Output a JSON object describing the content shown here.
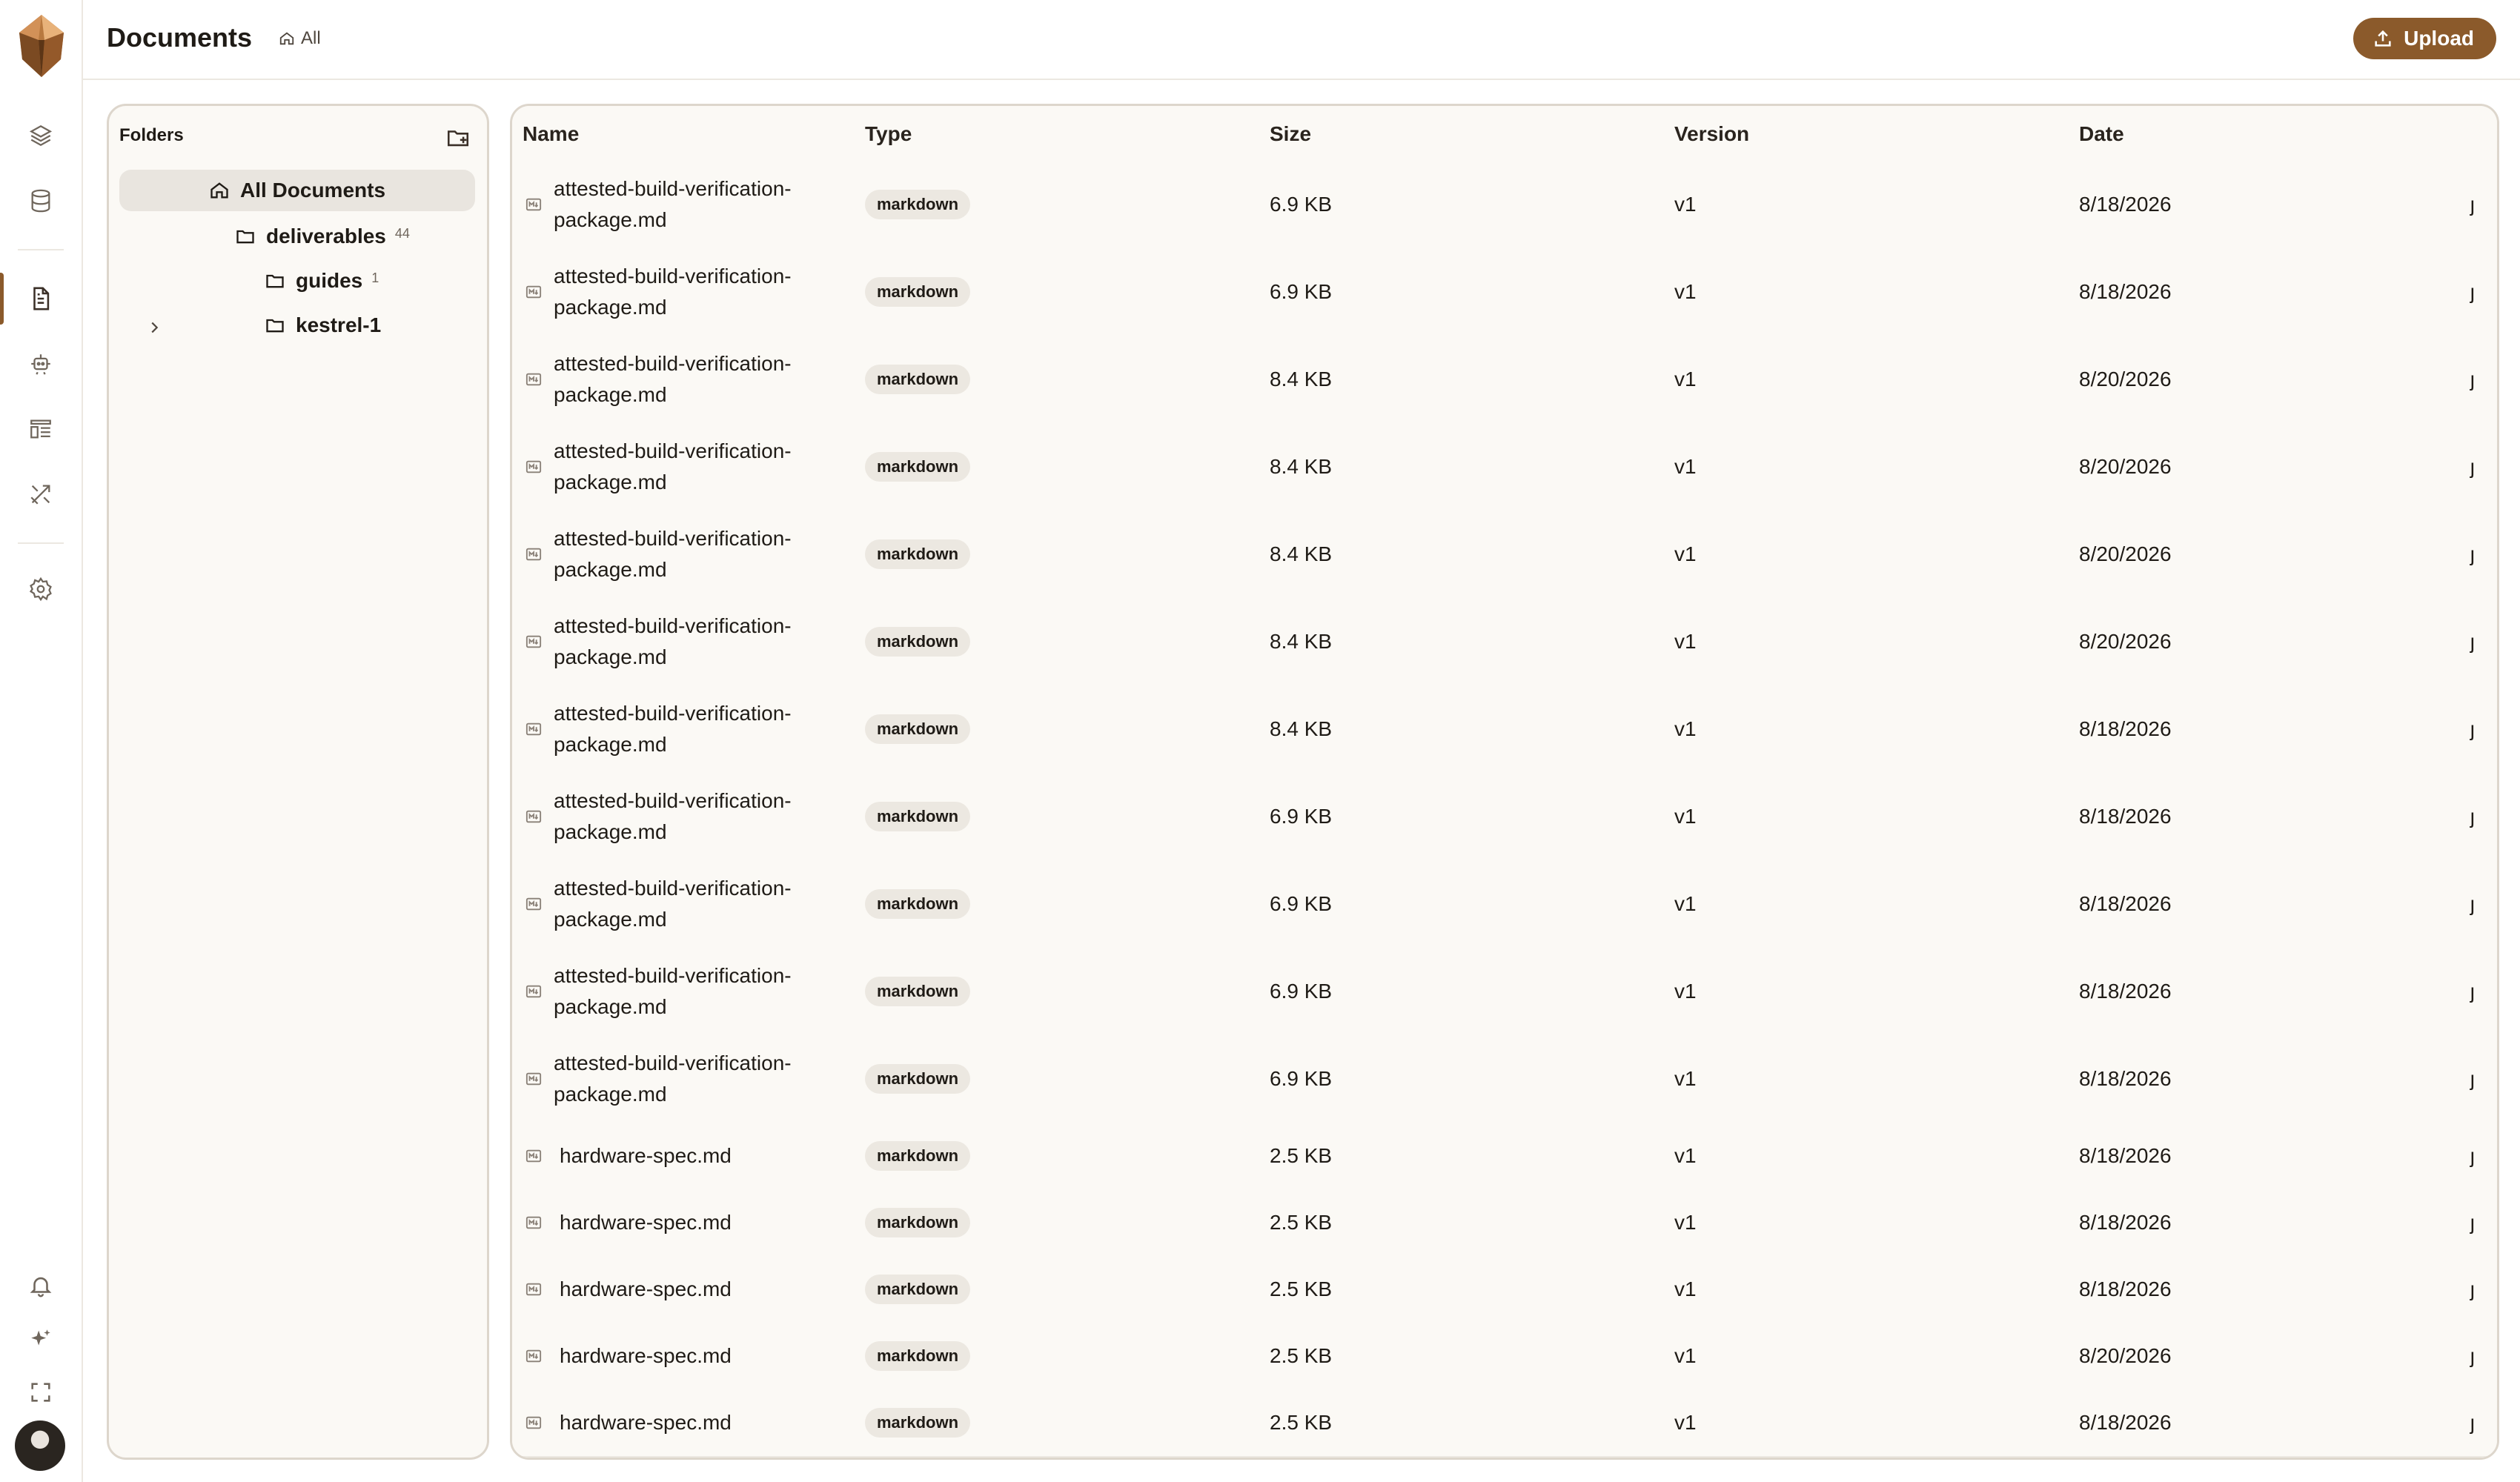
{
  "header": {
    "title": "Documents",
    "breadcrumb": "All",
    "upload_label": "Upload"
  },
  "folders": {
    "title": "Folders",
    "all_label": "All Documents",
    "items": [
      {
        "label": "deliverables",
        "count": "44"
      },
      {
        "label": "guides",
        "count": "1"
      },
      {
        "label": "kestrel-1",
        "count": ""
      }
    ]
  },
  "table": {
    "columns": [
      "Name",
      "Type",
      "Size",
      "Version",
      "Date"
    ],
    "rows": [
      {
        "name_line1": "attested-build-verification-",
        "name_line2": "package.md",
        "type": "markdown",
        "size": "6.9 KB",
        "version": "v1",
        "date": "8/18/2026"
      },
      {
        "name_line1": "attested-build-verification-",
        "name_line2": "package.md",
        "type": "markdown",
        "size": "6.9 KB",
        "version": "v1",
        "date": "8/18/2026"
      },
      {
        "name_line1": "attested-build-verification-",
        "name_line2": "package.md",
        "type": "markdown",
        "size": "8.4 KB",
        "version": "v1",
        "date": "8/20/2026"
      },
      {
        "name_line1": "attested-build-verification-",
        "name_line2": "package.md",
        "type": "markdown",
        "size": "8.4 KB",
        "version": "v1",
        "date": "8/20/2026"
      },
      {
        "name_line1": "attested-build-verification-",
        "name_line2": "package.md",
        "type": "markdown",
        "size": "8.4 KB",
        "version": "v1",
        "date": "8/20/2026"
      },
      {
        "name_line1": "attested-build-verification-",
        "name_line2": "package.md",
        "type": "markdown",
        "size": "8.4 KB",
        "version": "v1",
        "date": "8/20/2026"
      },
      {
        "name_line1": "attested-build-verification-",
        "name_line2": "package.md",
        "type": "markdown",
        "size": "8.4 KB",
        "version": "v1",
        "date": "8/18/2026"
      },
      {
        "name_line1": "attested-build-verification-",
        "name_line2": "package.md",
        "type": "markdown",
        "size": "6.9 KB",
        "version": "v1",
        "date": "8/18/2026"
      },
      {
        "name_line1": "attested-build-verification-",
        "name_line2": "package.md",
        "type": "markdown",
        "size": "6.9 KB",
        "version": "v1",
        "date": "8/18/2026"
      },
      {
        "name_line1": "attested-build-verification-",
        "name_line2": "package.md",
        "type": "markdown",
        "size": "6.9 KB",
        "version": "v1",
        "date": "8/18/2026"
      },
      {
        "name_line1": "attested-build-verification-",
        "name_line2": "package.md",
        "type": "markdown",
        "size": "6.9 KB",
        "version": "v1",
        "date": "8/18/2026"
      },
      {
        "name_line1": "hardware-spec.md",
        "name_line2": "",
        "type": "markdown",
        "size": "2.5 KB",
        "version": "v1",
        "date": "8/18/2026"
      },
      {
        "name_line1": "hardware-spec.md",
        "name_line2": "",
        "type": "markdown",
        "size": "2.5 KB",
        "version": "v1",
        "date": "8/18/2026"
      },
      {
        "name_line1": "hardware-spec.md",
        "name_line2": "",
        "type": "markdown",
        "size": "2.5 KB",
        "version": "v1",
        "date": "8/18/2026"
      },
      {
        "name_line1": "hardware-spec.md",
        "name_line2": "",
        "type": "markdown",
        "size": "2.5 KB",
        "version": "v1",
        "date": "8/20/2026"
      },
      {
        "name_line1": "hardware-spec.md",
        "name_line2": "",
        "type": "markdown",
        "size": "2.5 KB",
        "version": "v1",
        "date": "8/18/2026"
      }
    ]
  },
  "icons": {
    "rail": [
      "layers-icon",
      "database-icon",
      "document-icon",
      "robot-icon",
      "layout-list-icon",
      "tools-icon",
      "settings-icon",
      "bell-icon",
      "sparkles-icon",
      "fullscreen-icon"
    ],
    "file": "markdown-file-icon",
    "row_action": "more-icon"
  },
  "colors": {
    "accent": "#8b5a2b",
    "panel_bg": "#fbf9f5",
    "badge_bg": "#ece8e1",
    "border": "#ddd6cc"
  }
}
